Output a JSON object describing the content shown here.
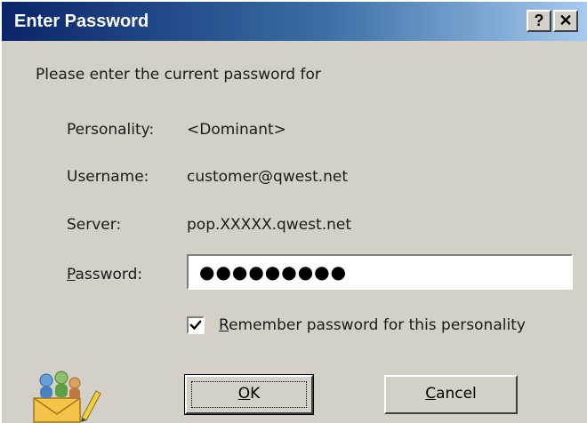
{
  "dialog": {
    "title": "Enter Password",
    "help_button": "?",
    "close_button": "✕"
  },
  "intro": "Please enter the current password for",
  "fields": {
    "personality_label": "Personality:",
    "personality_value": "<Dominant>",
    "username_label": "Username:",
    "username_value": "customer@qwest.net",
    "server_label": "Server:",
    "server_value": "pop.XXXXX.qwest.net",
    "password_label_accel": "P",
    "password_label_rest": "assword:",
    "password_value": "●●●●●●●●●"
  },
  "remember": {
    "checked": true,
    "label_accel": "R",
    "label_rest": "emember password for this personality"
  },
  "buttons": {
    "ok_accel": "O",
    "ok_rest": "K",
    "cancel_accel": "C",
    "cancel_rest": "ancel"
  },
  "icons": {
    "app_icon": "users-mail-icon",
    "help_icon": "help-icon",
    "close_icon": "close-icon",
    "checkmark_icon": "checkmark-icon"
  }
}
